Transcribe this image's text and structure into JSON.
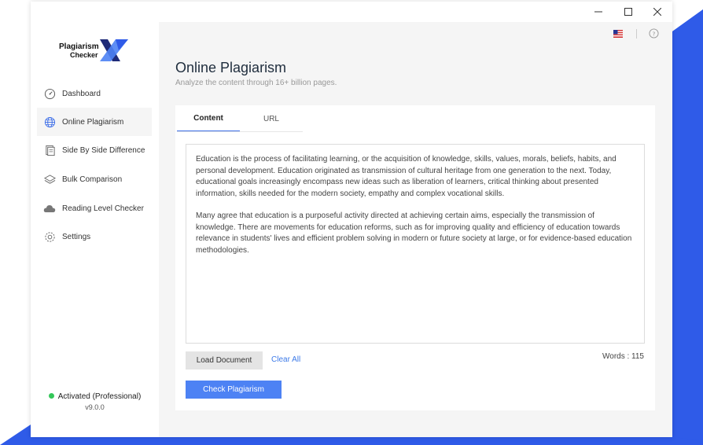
{
  "app": {
    "logo_line1": "Plagiarism",
    "logo_line2": "Checker",
    "accent_color": "#4d82f4",
    "brand_dark": "#1e2a78"
  },
  "window_controls": {
    "minimize_icon": "minimize-icon",
    "maximize_icon": "maximize-icon",
    "close_icon": "close-icon"
  },
  "sidebar": {
    "items": [
      {
        "label": "Dashboard",
        "icon": "gauge-icon",
        "active": false
      },
      {
        "label": "Online Plagiarism",
        "icon": "globe-icon",
        "active": true
      },
      {
        "label": "Side By Side Difference",
        "icon": "document-icon",
        "active": false
      },
      {
        "label": "Bulk Comparison",
        "icon": "layers-icon",
        "active": false
      },
      {
        "label": "Reading Level Checker",
        "icon": "cloud-icon",
        "active": false
      },
      {
        "label": "Settings",
        "icon": "gear-icon",
        "active": false
      }
    ],
    "status": "Activated (Professional)",
    "version": "v9.0.0"
  },
  "header": {
    "flag_icon": "us-flag-icon",
    "help_icon": "help-icon"
  },
  "main": {
    "title": "Online Plagiarism",
    "subtitle": "Analyze the content through 16+ billion pages.",
    "tabs": [
      {
        "label": "Content",
        "active": true
      },
      {
        "label": "URL",
        "active": false
      }
    ],
    "content_paragraphs": [
      "Education is the process of facilitating learning, or the acquisition of knowledge, skills, values, morals, beliefs, habits, and personal development. Education originated as transmission of cultural heritage from one generation to the next. Today, educational goals increasingly encompass new ideas such as liberation of learners, critical thinking about presented information, skills needed for the modern society, empathy and complex vocational skills.",
      "Many agree that education is a purposeful activity directed at achieving certain aims, especially the transmission of knowledge. There are movements for education reforms, such as for improving quality and efficiency of education towards relevance in students' lives and efficient problem solving in modern or future society at large, or for evidence-based education methodologies."
    ],
    "load_button": "Load Document",
    "clear_link": "Clear All",
    "word_count": "Words : 115",
    "check_button": "Check Plagiarism"
  }
}
